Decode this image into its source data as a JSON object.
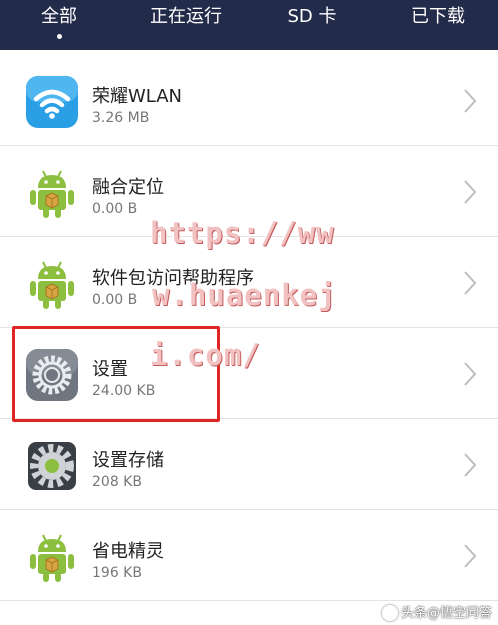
{
  "tabs": [
    {
      "label": "全部",
      "active": true
    },
    {
      "label": "正在运行",
      "active": false
    },
    {
      "label": "SD 卡",
      "active": false
    },
    {
      "label": "已下载",
      "active": false
    }
  ],
  "apps": [
    {
      "name": "荣耀WLAN",
      "size": "3.26 MB",
      "icon": "wifi-icon"
    },
    {
      "name": "融合定位",
      "size": "0.00 B",
      "icon": "android-icon"
    },
    {
      "name": "软件包访问帮助程序",
      "size": "0.00 B",
      "icon": "android-icon"
    },
    {
      "name": "设置",
      "size": "24.00 KB",
      "icon": "settings-gear-icon"
    },
    {
      "name": "设置存储",
      "size": "208 KB",
      "icon": "settings-storage-icon"
    },
    {
      "name": "省电精灵",
      "size": "196 KB",
      "icon": "android-icon"
    }
  ],
  "watermark": {
    "line1": "https://ww",
    "line2": "w.huaenkej",
    "line3": "i.com/"
  },
  "corner_watermark": "头条@悟空问答",
  "colors": {
    "tabbar": "#232b4a",
    "highlight_box": "#e02525",
    "android_green": "#8cbf3f",
    "wifi_blue": "#2a9fe6"
  }
}
